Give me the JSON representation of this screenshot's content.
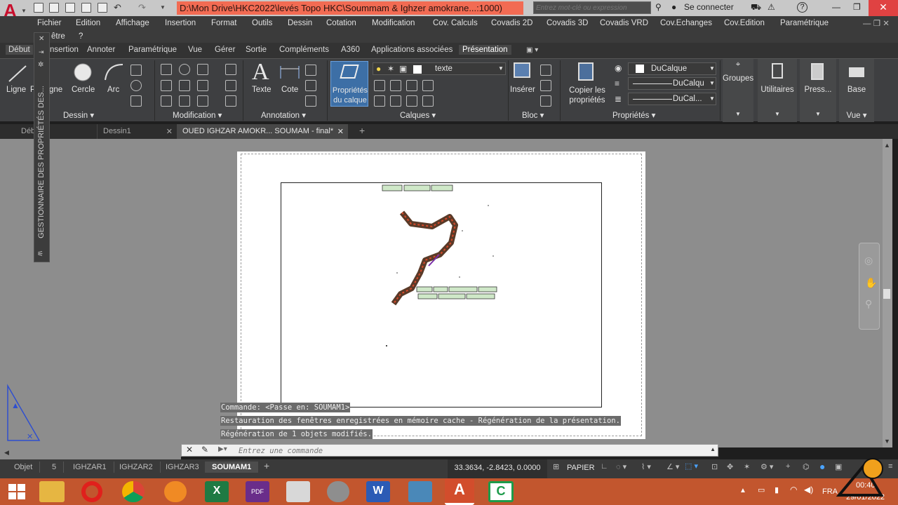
{
  "title_bar": {
    "path": "D:\\Mon Drive\\HKC2022\\levés Topo HKC\\Soummam & Ighzer amokrane...:1000)",
    "search_placeholder": "Entrez mot-clé ou expression",
    "login": "Se connecter",
    "help": "?"
  },
  "menu": {
    "row1": [
      "Fichier",
      "Edition",
      "Affichage",
      "Insertion",
      "Format",
      "Outils",
      "Dessin",
      "Cotation",
      "Modification",
      "Cov. Calculs",
      "Covadis 2D",
      "Covadis 3D",
      "Covadis VRD",
      "Cov.Echanges",
      "Cov.Edition",
      "Paramétrique"
    ],
    "row2": [
      "être",
      "?"
    ]
  },
  "ribbon_tabs": [
    "Début",
    "nsertion",
    "Annoter",
    "Paramétrique",
    "Vue",
    "Gérer",
    "Sortie",
    "Compléments",
    "A360",
    "Applications associées",
    "Présentation"
  ],
  "ribbon": {
    "dessin": {
      "ligne": "Ligne",
      "p": "P",
      "ligne2": "gne",
      "cercle": "Cercle",
      "arc": "Arc",
      "panel": "Dessin"
    },
    "modification": {
      "panel": "Modification"
    },
    "annotation": {
      "texte": "Texte",
      "cote": "Cote",
      "panel": "Annotation"
    },
    "calques": {
      "proprietes": "Propriétés du calque",
      "layer": "texte",
      "panel": "Calques"
    },
    "bloc": {
      "inserer": "Insérer",
      "panel": "Bloc"
    },
    "proprietes": {
      "copier": "Copier les propriétés",
      "ducalque1": "DuCalque",
      "ducalque2": "DuCalqu",
      "ducalque3": "DuCal...",
      "panel": "Propriétés"
    },
    "groupes": "Groupes",
    "utilitaires": "Utilitaires",
    "press": "Press...",
    "base": "Base",
    "vue": "Vue"
  },
  "doc_tabs": [
    "Déb",
    "Dessin1",
    "OUED IGHZAR AMOKR... SOUMAM - final*",
    "+"
  ],
  "side_palette": "GESTIONNAIRE DES PROPRIÉTÉS DES...",
  "command_history": [
    "Commande:   <Passe en: SOUMAM1>",
    "Restauration des fenêtres enregistrées en mémoire cache - Régénération de la présentation.",
    "Régénération de 1 objets modifiés."
  ],
  "command_placeholder": "Entrez une commande",
  "layout_tabs": [
    "Objet",
    "5",
    "IGHZAR1",
    "IGHZAR2",
    "IGHZAR3",
    "SOUMAM1",
    "+"
  ],
  "status": {
    "coords": "33.3634, -2.8423, 0.0000",
    "space": "PAPIER",
    "lang": "FRA",
    "time": "00:40",
    "date": "29/01/2022"
  },
  "colors": {
    "title_red": "#f26b53",
    "taskbar": "#c2562e",
    "workspace": "#8d8d8d",
    "accent": "#2f6fbf"
  }
}
